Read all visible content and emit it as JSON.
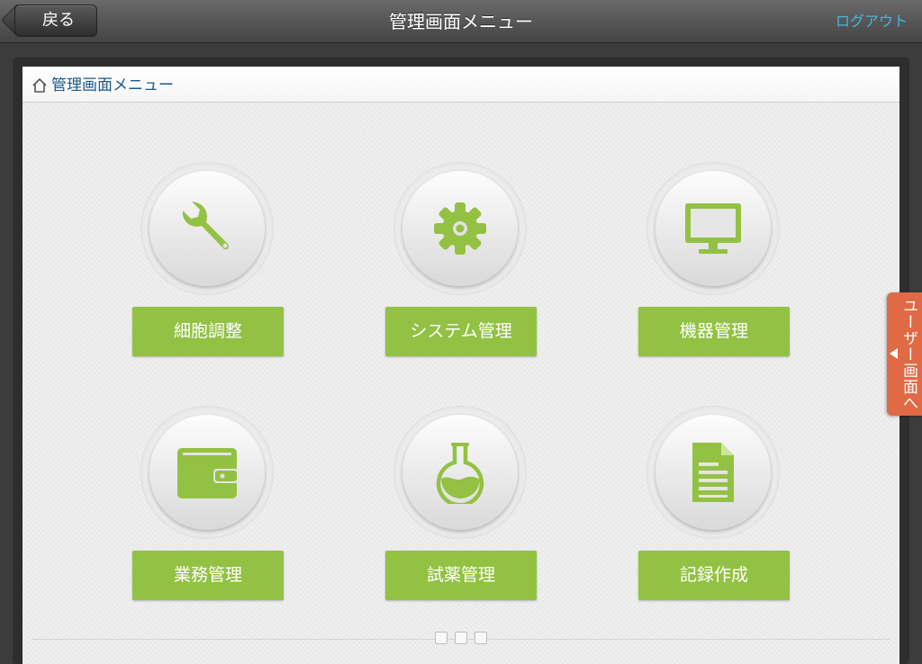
{
  "header": {
    "back_label": "戻る",
    "title": "管理画面メニュー",
    "logout_label": "ログアウト"
  },
  "breadcrumb": {
    "icon": "home-icon",
    "label": "管理画面メニュー"
  },
  "menu": [
    {
      "label": "細胞調整",
      "icon": "wrench-icon"
    },
    {
      "label": "システム管理",
      "icon": "gear-icon"
    },
    {
      "label": "機器管理",
      "icon": "monitor-icon"
    },
    {
      "label": "業務管理",
      "icon": "wallet-icon"
    },
    {
      "label": "試薬管理",
      "icon": "flask-icon"
    },
    {
      "label": "記録作成",
      "icon": "document-icon"
    }
  ],
  "side_tab": {
    "label": "ユーザー画面へ",
    "icon": "triangle-left-icon"
  },
  "pager": {
    "pages": 3
  },
  "colors": {
    "accent_green": "#93c143",
    "side_tab_orange": "#e06a45",
    "link_blue": "#48b6e0"
  }
}
